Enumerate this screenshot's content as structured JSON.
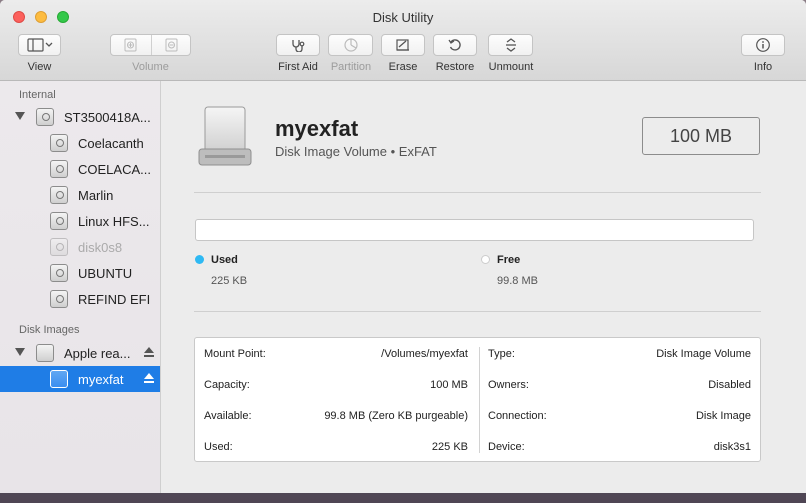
{
  "window": {
    "title": "Disk Utility"
  },
  "toolbar": {
    "view": "View",
    "volume": "Volume",
    "first_aid": "First Aid",
    "partition": "Partition",
    "erase": "Erase",
    "restore": "Restore",
    "unmount": "Unmount",
    "info": "Info"
  },
  "sidebar": {
    "internal_header": "Internal",
    "internal_items": [
      {
        "label": "ST3500418A...",
        "level": 0,
        "disabled": false
      },
      {
        "label": "Coelacanth",
        "level": 1,
        "disabled": false
      },
      {
        "label": "COELACA...",
        "level": 1,
        "disabled": false
      },
      {
        "label": "Marlin",
        "level": 1,
        "disabled": false
      },
      {
        "label": "Linux HFS...",
        "level": 1,
        "disabled": false
      },
      {
        "label": "disk0s8",
        "level": 1,
        "disabled": true
      },
      {
        "label": "UBUNTU",
        "level": 1,
        "disabled": false
      },
      {
        "label": "REFIND EFI",
        "level": 1,
        "disabled": false
      }
    ],
    "images_header": "Disk Images",
    "image_items": [
      {
        "label": "Apple rea...",
        "level": 0,
        "ejectable": true
      },
      {
        "label": "myexfat",
        "level": 1,
        "ejectable": true,
        "selected": true
      }
    ]
  },
  "volume": {
    "name": "myexfat",
    "subtitle": "Disk Image Volume • ExFAT",
    "size": "100 MB"
  },
  "usage": {
    "used_label": "Used",
    "used_value": "225 KB",
    "used_color": "#2eb9f3",
    "free_label": "Free",
    "free_value": "99.8 MB",
    "free_color": "#ffffff"
  },
  "info": {
    "left": [
      {
        "key": "Mount Point:",
        "value": "/Volumes/myexfat"
      },
      {
        "key": "Capacity:",
        "value": "100 MB"
      },
      {
        "key": "Available:",
        "value": "99.8 MB (Zero KB purgeable)"
      },
      {
        "key": "Used:",
        "value": "225 KB"
      }
    ],
    "right": [
      {
        "key": "Type:",
        "value": "Disk Image Volume"
      },
      {
        "key": "Owners:",
        "value": "Disabled"
      },
      {
        "key": "Connection:",
        "value": "Disk Image"
      },
      {
        "key": "Device:",
        "value": "disk3s1"
      }
    ]
  }
}
